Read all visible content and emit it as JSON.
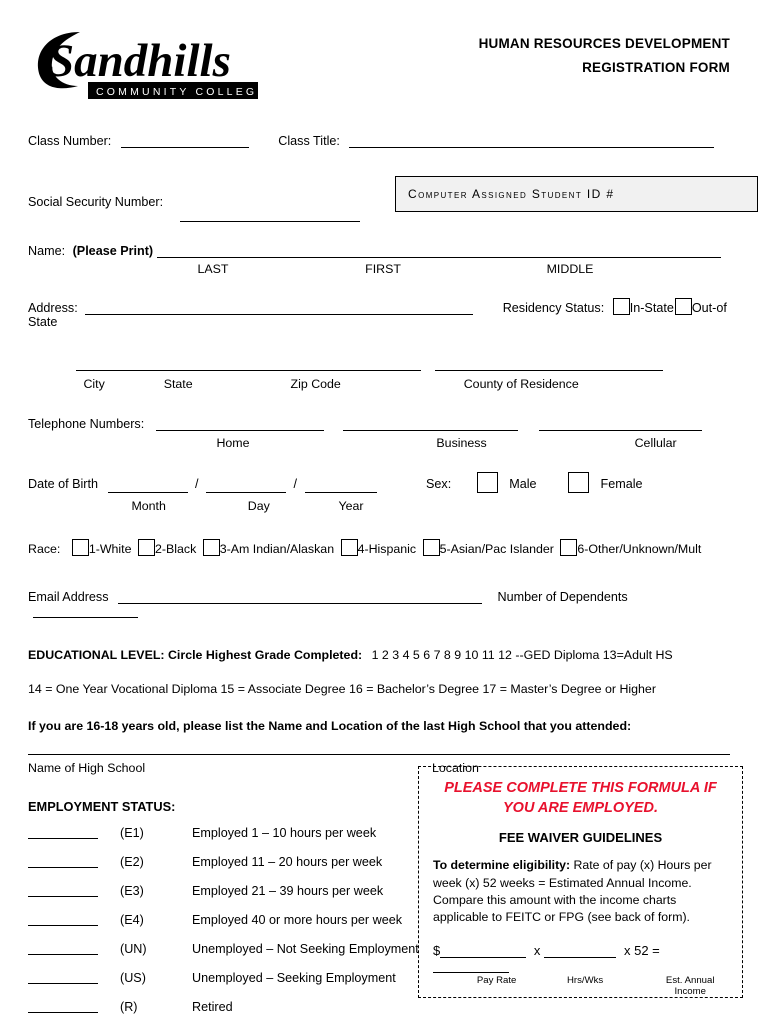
{
  "header": {
    "logo_main": "Sandhills",
    "logo_sub": "COMMUNITY COLLEGE",
    "title_line1": "HUMAN RESOURCES DEVELOPMENT",
    "title_line2": "REGISTRATION FORM"
  },
  "fields": {
    "class_number_label": "Class Number:",
    "class_title_label": "Class Title:",
    "ssn_label": "Social Security Number:",
    "student_id_box": "Computer Assigned Student ID #",
    "name_label": "Name:",
    "name_bold": "(Please Print)",
    "name_last": "LAST",
    "name_first": "FIRST",
    "name_middle": "MIDDLE",
    "address_label": "Address:",
    "residency_label": "Residency Status:",
    "residency_in": "In-State",
    "residency_out": "Out-of State",
    "city": "City",
    "state": "State",
    "zip": "Zip Code",
    "county": "County of Residence",
    "telephone_label": "Telephone Numbers:",
    "phone_home": "Home",
    "phone_business": "Business",
    "phone_cellular": "Cellular",
    "dob_label": "Date of Birth",
    "dob_month": "Month",
    "dob_day": "Day",
    "dob_year": "Year",
    "sex_label": "Sex:",
    "sex_male": "Male",
    "sex_female": "Female",
    "race_label": "Race:",
    "race_options": [
      "1-White",
      "2-Black",
      "3-Am Indian/Alaskan",
      "4-Hispanic",
      "5-Asian/Pac Islander",
      "6-Other/Unknown/Mult"
    ],
    "email_label": "Email Address",
    "dependents_label": "Number of Dependents"
  },
  "education": {
    "heading": "EDUCATIONAL LEVEL",
    "heading_rest": ": Circle Highest Grade Completed:",
    "grades": "1  2  3  4  5  6  7  8  9  10  11  12  --GED Diploma  13=Adult HS",
    "line2": "14 = One Year Vocational Diploma     15 = Associate Degree     16 = Bachelor’s Degree     17 = Master’s Degree or Higher",
    "hs_question": "If you are 16-18 years old, please list the Name and Location of the last High School that you attended:",
    "hs_name": "Name of High School",
    "hs_location": "Location"
  },
  "employment": {
    "heading": "EMPLOYMENT STATUS:",
    "rows": [
      {
        "code": "(E1)",
        "desc": "Employed 1 – 10 hours per week"
      },
      {
        "code": "(E2)",
        "desc": "Employed 11 – 20 hours per week"
      },
      {
        "code": "(E3)",
        "desc": "Employed 21 – 39 hours per week"
      },
      {
        "code": "(E4)",
        "desc": "Employed 40 or more hours per week"
      },
      {
        "code": "(UN)",
        "desc": "Unemployed – Not Seeking Employment"
      },
      {
        "code": "(US)",
        "desc": "Unemployed – Seeking Employment"
      },
      {
        "code": "(R)",
        "desc": "Retired"
      }
    ]
  },
  "formula_box": {
    "title_line1": "PLEASE COMPLETE THIS FORMULA IF",
    "title_line2": "YOU ARE EMPLOYED.",
    "subtitle": "FEE WAIVER GUIDELINES",
    "body_bold": "To determine eligibility:",
    "body_text": " Rate of pay (x) Hours per week (x) 52 weeks = Estimated Annual Income. Compare this amount with the income charts applicable to FEITC or FPG (see back of form).",
    "dollar": "$",
    "times1": "x",
    "times2": "x 52 =",
    "cap_pay": "Pay Rate",
    "cap_hrs": "Hrs/Wks",
    "cap_income": "Est. Annual Income"
  },
  "colors": {
    "red": "#e8112d",
    "box_gray": "#f1f1f1"
  }
}
